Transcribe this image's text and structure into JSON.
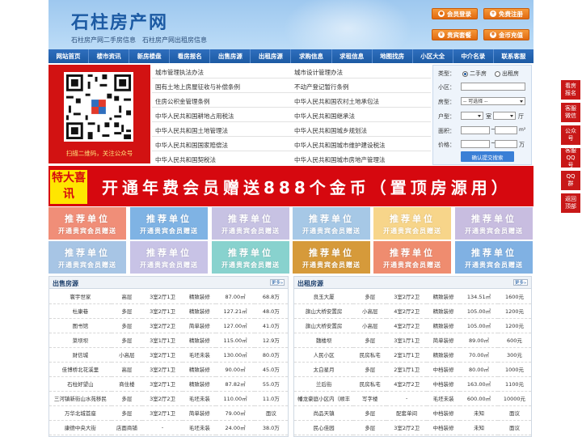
{
  "header": {
    "title": "石柱房产网",
    "subtitle": "石柱房产网二手房信息　石柱房产网出租房信息",
    "buttons": {
      "member_login": "会员登录",
      "register": "免费注册",
      "package": "贵宾套餐",
      "recharge": "金币充值"
    }
  },
  "nav": [
    "网站首页",
    "楼市资讯",
    "新房楼盘",
    "看房报名",
    "出售房源",
    "出租房源",
    "求购信息",
    "求租信息",
    "地图找房",
    "小区大全",
    "中介名录",
    "联系客服"
  ],
  "qr": {
    "caption": "扫描二维码，关注公众号"
  },
  "links": [
    [
      "城市管理执法办法",
      "城市设计管理办法"
    ],
    [
      "国有土地上房屋征收与补偿条例",
      "不动产登记暂行条例"
    ],
    [
      "住房公积金管理条例",
      "中华人民共和国农村土地承包法"
    ],
    [
      "中华人民共和国耕地占用税法",
      "中华人民共和国继承法"
    ],
    [
      "中华人民共和国土地管理法",
      "中华人民共和国城乡规划法"
    ],
    [
      "中华人民共和国国家赔偿法",
      "中华人民共和国城市维护建设税法"
    ],
    [
      "中华人民共和国契税法",
      "中华人民共和国城市房地产管理法"
    ]
  ],
  "search": {
    "type_label": "类型：",
    "opt_sale": "二手房",
    "opt_rent": "出租房",
    "community_label": "小区：",
    "house_type_label": "房型：",
    "house_type_value": "-- 可选择 --",
    "layout_label": "户型：",
    "room_unit": "室",
    "hall_unit": "厅",
    "area_label": "面积：",
    "price_label": "价格：",
    "tilde": "~",
    "area_unit": "m²",
    "price_unit": "万",
    "submit": "确认提交搜索"
  },
  "side": [
    "看房报名",
    "客服微信",
    "公众号",
    "客服QQ号",
    "QQ群",
    "返回顶部"
  ],
  "banner": {
    "tag": "特大喜讯",
    "text": "开通年费会员赠送888个金币（置顶房源用）"
  },
  "recommend": {
    "line1": "推荐单位",
    "line2": "开通贵宾会员赠送"
  },
  "sale_panel": {
    "title": "出售房源",
    "more": "更多»",
    "rows": [
      [
        "寰宇世家",
        "高层",
        "3室2厅1卫",
        "精致装修",
        "87.00㎡",
        "68.8万"
      ],
      [
        "杜康巷",
        "多层",
        "3室2厅1卫",
        "精致装修",
        "127.21㎡",
        "48.0万"
      ],
      [
        "图书馆",
        "多层",
        "3室2厅2卫",
        "简单装修",
        "127.00㎡",
        "41.0万"
      ],
      [
        "菜坝坝",
        "多层",
        "3室1厅1卫",
        "精致装修",
        "115.00㎡",
        "12.9万"
      ],
      [
        "财信城",
        "小高层",
        "3室2厅1卫",
        "毛坯未装",
        "130.00㎡",
        "80.0万"
      ],
      [
        "佳博桥北花溪里",
        "高层",
        "3室2厅1卫",
        "精致装修",
        "90.00㎡",
        "45.0万"
      ],
      [
        "石柱好望山",
        "商住楼",
        "3室2厅1卫",
        "精致装修",
        "87.82㎡",
        "55.0万"
      ],
      [
        "三河镇新街山水苑移民",
        "多层",
        "3室2厅2卫",
        "毛坯未装",
        "110.00㎡",
        "11.0万"
      ],
      [
        "万华北城首座",
        "多层",
        "3室2厅1卫",
        "简单装修",
        "79.00㎡",
        "面议"
      ],
      [
        "康德中央大街",
        "店面商铺",
        "-",
        "毛坯未装",
        "24.00㎡",
        "38.0万"
      ]
    ]
  },
  "rent_panel": {
    "title": "出租房源",
    "more": "更多»",
    "rows": [
      [
        "良玉大厦",
        "多层",
        "3室2厅2卫",
        "精致装修",
        "134.51㎡",
        "1600元"
      ],
      [
        "旗山大桥安置房",
        "小高层",
        "4室2厅2卫",
        "精致装修",
        "105.00㎡",
        "1200元"
      ],
      [
        "旗山大桥安置房",
        "小高层",
        "4室2厅2卫",
        "精致装修",
        "105.00㎡",
        "1200元"
      ],
      [
        "魏楼坝",
        "多层",
        "3室1厅1卫",
        "简单装修",
        "89.00㎡",
        "600元"
      ],
      [
        "人民小区",
        "民房私宅",
        "2室1厅1卫",
        "精致装修",
        "70.00㎡",
        "300元"
      ],
      [
        "太白星月",
        "多层",
        "2室1厅1卫",
        "中档装修",
        "80.00㎡",
        "1000元"
      ],
      [
        "兰后街",
        "民房私宅",
        "4室2厅2卫",
        "中档装修",
        "163.00㎡",
        "1100元"
      ],
      [
        "幡龙豪庭小区内（顺丰",
        "写字楼",
        "-",
        "毛坯未装",
        "600.00㎡",
        "10000元"
      ],
      [
        "尚品天镇",
        "多层",
        "配套单间",
        "中档装修",
        "未知",
        "面议"
      ],
      [
        "民心佳园",
        "多层",
        "3室2厅2卫",
        "中档装修",
        "未知",
        "面议"
      ]
    ]
  },
  "colors": {
    "brand_blue": "#1c5aa3",
    "banner_red": "#d6080f",
    "header_orange": "#e16a10",
    "rec_colors": [
      "#f08e78",
      "#7fb3e4",
      "#c7c2e3",
      "#a6c8e6",
      "#f7d58a",
      "#c8bde0",
      "#a7c5e5",
      "#c8c3e6",
      "#88d2ce",
      "#d69a3a",
      "#ef8c6f",
      "#80b1e3"
    ]
  }
}
